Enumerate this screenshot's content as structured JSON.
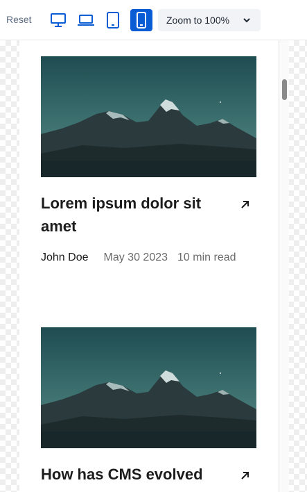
{
  "toolbar": {
    "reset_label": "Reset",
    "devices": [
      {
        "name": "desktop-icon",
        "active": false
      },
      {
        "name": "laptop-icon",
        "active": false
      },
      {
        "name": "tablet-icon",
        "active": false
      },
      {
        "name": "mobile-icon",
        "active": true
      }
    ],
    "zoom_label": "Zoom to 100%"
  },
  "colors": {
    "accent": "#0a5cd5",
    "title_text": "#1c1c1c",
    "meta_text": "#6b6b6b"
  },
  "posts": [
    {
      "title": "Lorem ipsum dolor sit amet",
      "author": "John Doe",
      "date": "May 30 2023",
      "read_time": "10 min read",
      "image": "mountain-landscape"
    },
    {
      "title": "How has CMS evolved",
      "image": "mountain-landscape"
    }
  ]
}
